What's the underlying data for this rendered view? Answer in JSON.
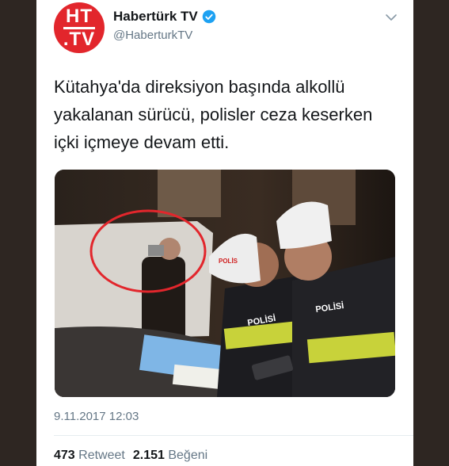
{
  "account": {
    "avatar_line1": "HT",
    "avatar_line2": ".TV",
    "display_name": "Habertürk TV",
    "handle": "@HaberturkTV"
  },
  "tweet": {
    "text": "Kütahya'da direksiyon başında alkollü yakalanan sürücü, polisler ceza keserken içki içmeye devam etti.",
    "timestamp": "9.11.2017 12:03"
  },
  "photo": {
    "vest_text_1": "POLİSİ",
    "vest_text_2": "POLİSİ",
    "cap_text": "POLİS"
  },
  "stats": {
    "retweets": "473",
    "retweets_label": "Retweet",
    "likes": "2.151",
    "likes_label": "Beğeni"
  },
  "colors": {
    "brand_red": "#e2262c",
    "verified_blue": "#1da1f2",
    "text": "#14171a",
    "muted": "#657786"
  }
}
